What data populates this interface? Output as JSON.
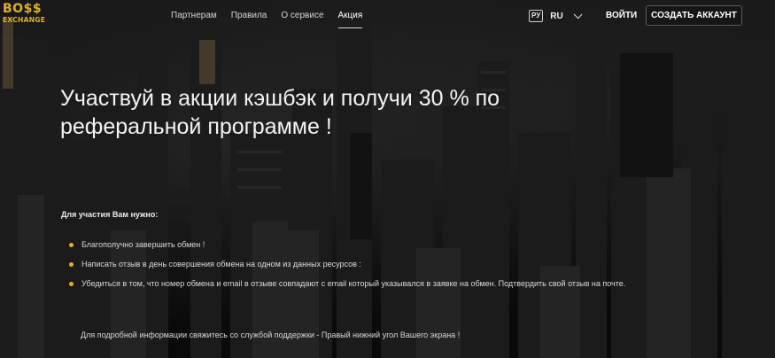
{
  "logo": {
    "line1": "BO$$",
    "line2": "EXCHANGE"
  },
  "nav": {
    "items": [
      {
        "label": "Партнерам",
        "active": false
      },
      {
        "label": "Правила",
        "active": false
      },
      {
        "label": "О сервисе",
        "active": false
      },
      {
        "label": "Акция",
        "active": true
      }
    ]
  },
  "lang": {
    "badge": "РУ",
    "code": "RU",
    "icon": "chevron-down-icon"
  },
  "auth": {
    "login_label": "ВОЙТИ",
    "signup_label": "СОЗДАТЬ АККАУНТ"
  },
  "hero": {
    "title": "Участвуй в акции кэшбэк и получи 30 % по реферальной программе !"
  },
  "requirements": {
    "title": "Для участия Вам нужно:",
    "items": [
      "Благополучно завершить обмен !",
      "Написать отзыв в день совершения обмена на одном из данных ресурсов :",
      "Убедиться в том, что номер обмена и email в отзыве совпадают с email который указывался в заявке на обмен. Подтвердить свой отзыв на почте."
    ]
  },
  "footer_note": "Для подробной информации свяжитесь со службой поддержки - Правый нижний угол Вашего экрана !",
  "colors": {
    "accent": "#e0b02c",
    "background": "#151515",
    "text": "#e9e9e9"
  }
}
